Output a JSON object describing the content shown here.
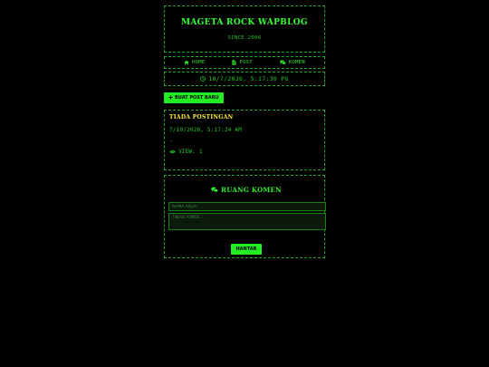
{
  "header": {
    "title": "MAGETA ROCK WAPBLOG",
    "since": "SINCE 2006"
  },
  "nav": [
    {
      "icon": "home-icon",
      "label": "HOME"
    },
    {
      "icon": "file-icon",
      "label": "POST"
    },
    {
      "icon": "comments-icon",
      "label": "KOMEN"
    }
  ],
  "clock": {
    "icon": "clock-icon",
    "text": "10/7/2026, 5:17:30 PG"
  },
  "new_post_button": {
    "icon": "plus-icon",
    "label": "BUAT POST BARU"
  },
  "post": {
    "title": "TIADA POSTINGAN",
    "date": "7/10/2026, 5:17:24 AM",
    "body": "-",
    "views_icon": "eye-icon",
    "views": "VIEW: 1"
  },
  "comment": {
    "icon": "comments-icon",
    "heading": "RUANG KOMEN",
    "name_placeholder": "NAMA ANDA",
    "message_placeholder": "TAKAN KOMEN...",
    "send_label": "HANTAR"
  },
  "colors": {
    "accent": "#22ee22",
    "background": "#000000",
    "title_yellow": "#ffee33",
    "border": "#1fa81f"
  }
}
